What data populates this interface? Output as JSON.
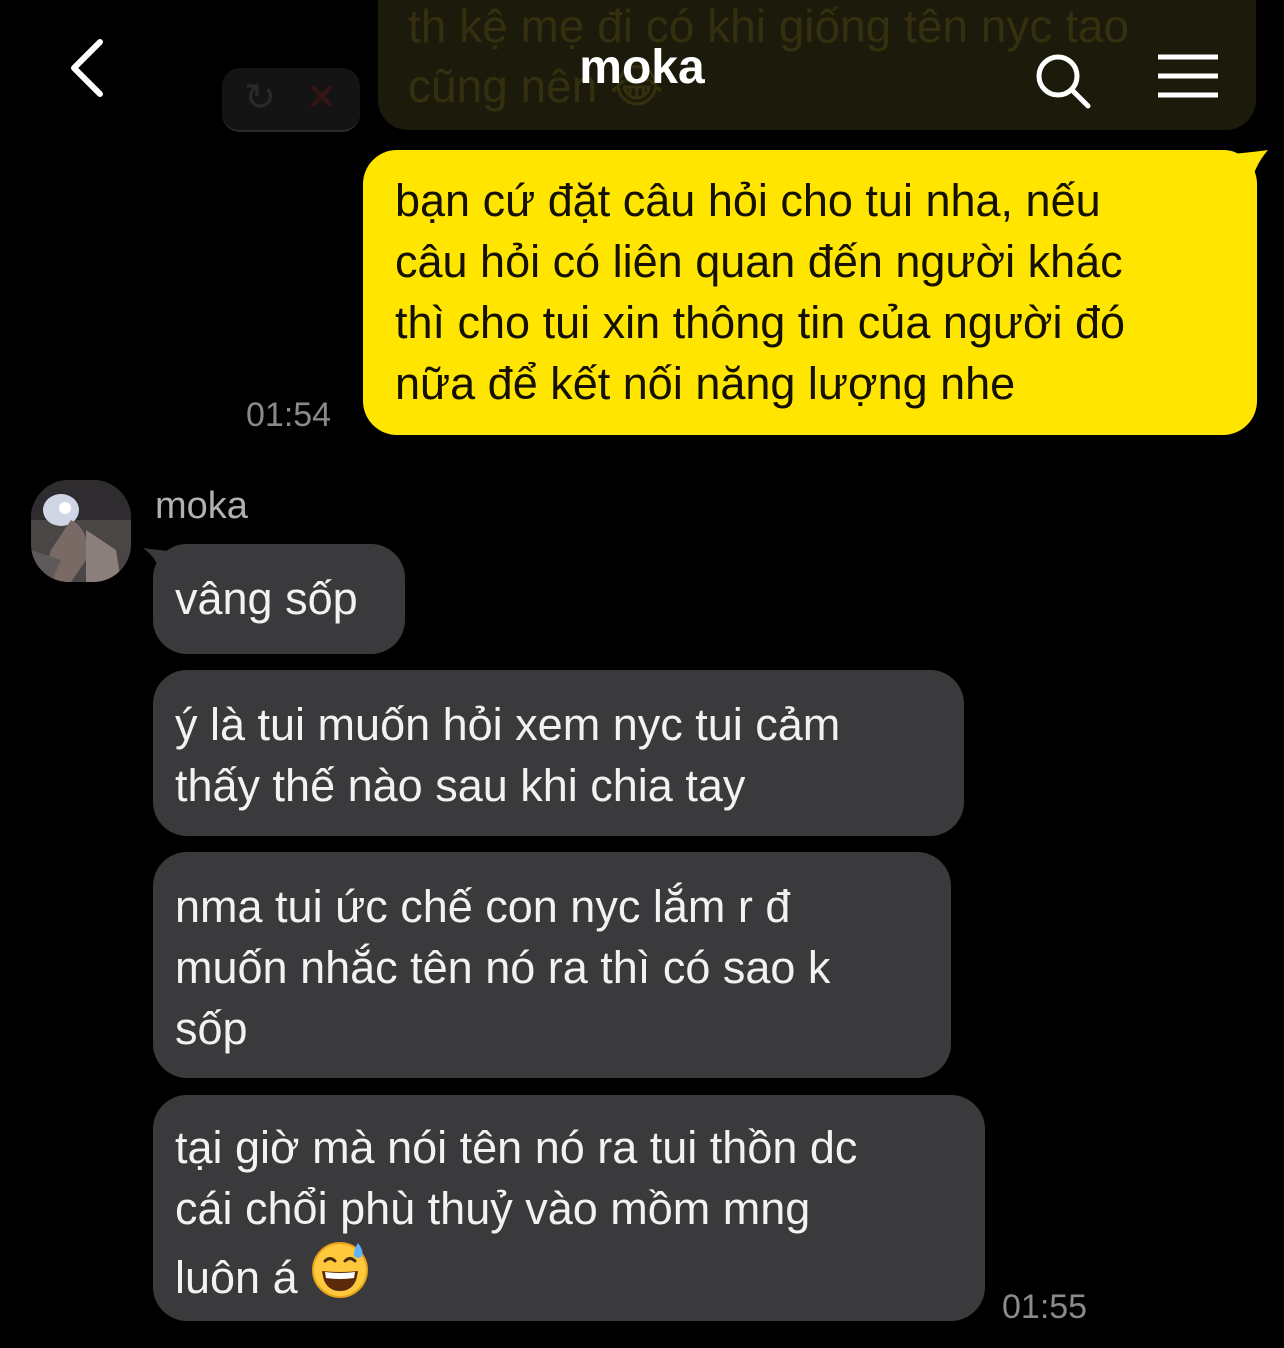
{
  "header": {
    "back_icon": "chevron-left-icon",
    "title": "moka",
    "search_icon": "search-icon",
    "menu_icon": "menu-icon"
  },
  "previous_message": {
    "text": "th kệ mẹ đi có khi giống tên nyc tao\ncũng nên 😂",
    "retry_icon": "retry-icon",
    "cancel_icon": "close-icon"
  },
  "messages": [
    {
      "direction": "outgoing",
      "text": "bạn cứ đặt câu hỏi cho tui nha, nếu\ncâu hỏi có liên quan đến người khác\nthì cho tui xin thông tin của người đó\nnữa để kết nối năng lượng nhe",
      "time": "01:54",
      "bubble_color": "#ffe500"
    },
    {
      "direction": "incoming",
      "sender": "moka",
      "text": "vâng sốp"
    },
    {
      "direction": "incoming",
      "text": "ý là tui muốn hỏi xem nyc tui cảm\nthấy thế nào sau khi chia tay"
    },
    {
      "direction": "incoming",
      "text": "nma tui ức chế con nyc lắm r đ\nmuốn nhắc tên nó ra thì có sao k\nsốp"
    },
    {
      "direction": "incoming",
      "text": "tại giờ mà nói tên nó ra tui thồn dc\ncái chổi phù thuỷ vào mồm mng\nluôn á ",
      "emoji": "grinning-sweat-emoji",
      "time": "01:55",
      "bubble_color": "#3a3a3c"
    }
  ],
  "colors": {
    "background": "#000000",
    "outgoing_bubble": "#ffe500",
    "incoming_bubble": "#3a3a3c",
    "timestamp": "#8a8a8a"
  }
}
